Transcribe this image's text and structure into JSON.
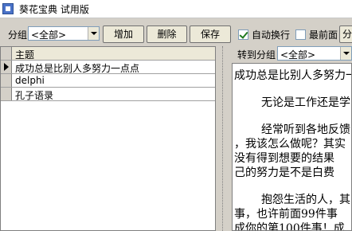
{
  "window": {
    "title": "葵花宝典 试用版"
  },
  "toolbar": {
    "group_label": "分组",
    "group_value": "<全部>",
    "add_label": "增加",
    "delete_label": "删除",
    "save_label": "保存",
    "auto_wrap_label": "自动换行",
    "auto_wrap_checked": true,
    "topmost_label": "最前面",
    "topmost_checked": false,
    "partial_button_label": "分"
  },
  "grid": {
    "header": "主题",
    "rows": [
      "成功总是比别人多努力一点点",
      "delphi",
      "孔子语录"
    ],
    "selected_index": 0
  },
  "right": {
    "move_to_group_label": "转到分组",
    "move_to_group_value": "<全部>",
    "content_lines": [
      "成功总是比别人多努力一点点",
      "无论是工作还是学习",
      "经常听到各地反馈",
      "，我该怎么做呢？其实",
      "没有得到想要的结果",
      "己的努力是不是白费",
      "抱怨生活的人，其",
      "事，也许前面99件事",
      "成你的第100件事！成"
    ]
  }
}
